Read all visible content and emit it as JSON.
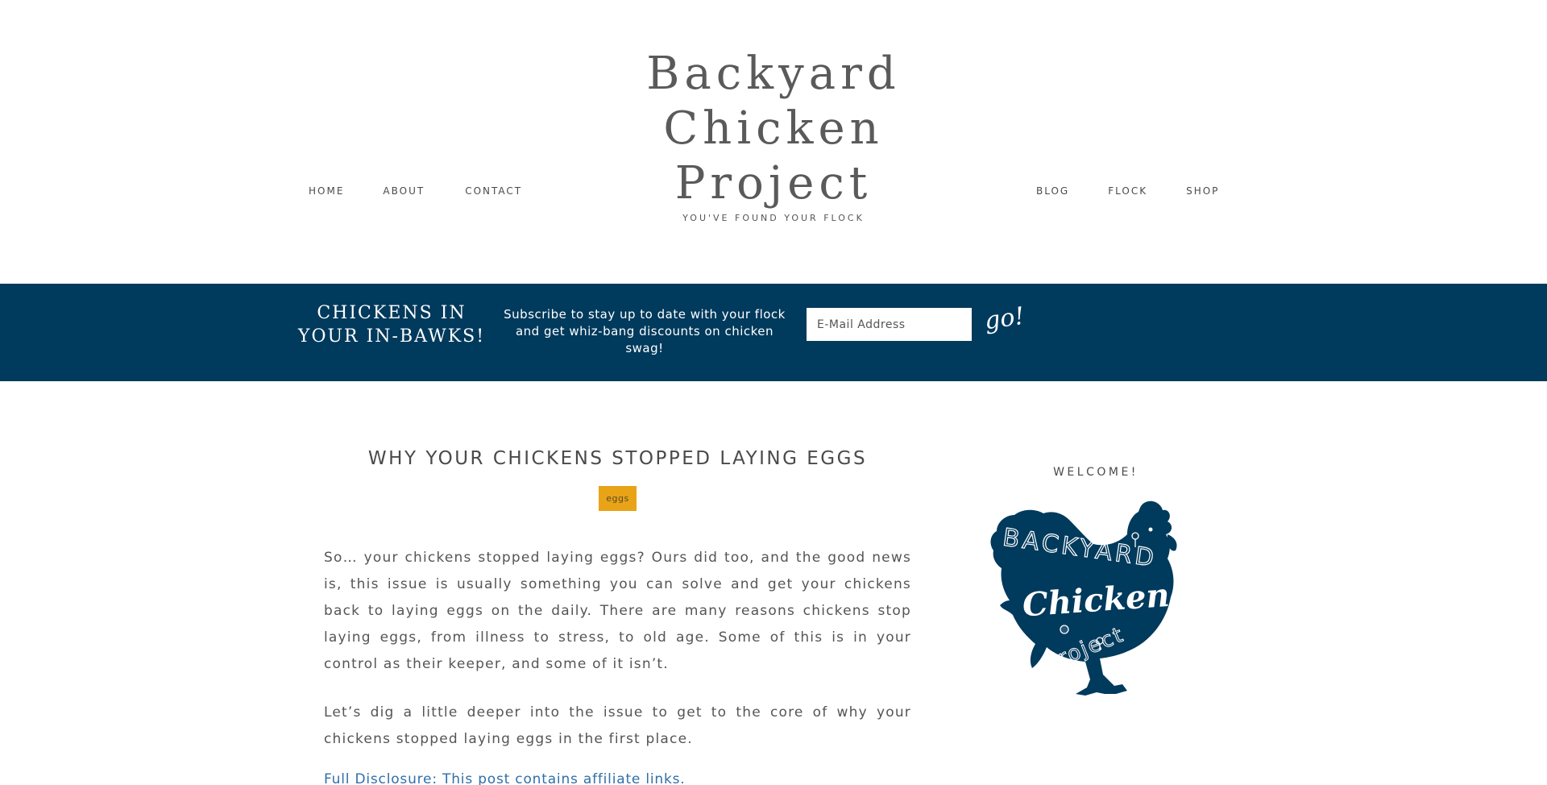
{
  "site": {
    "title_lines": [
      "Backyard",
      "Chicken",
      "Project"
    ],
    "tagline": "YOU'VE FOUND YOUR FLOCK"
  },
  "nav": {
    "left": [
      {
        "label": "HOME"
      },
      {
        "label": "ABOUT"
      },
      {
        "label": "CONTACT"
      }
    ],
    "right": [
      {
        "label": "BLOG"
      },
      {
        "label": "FLOCK"
      },
      {
        "label": "SHOP"
      }
    ]
  },
  "subscribe": {
    "heading_lines": [
      "CHICKENS IN",
      "YOUR IN-BAWKS!"
    ],
    "text": "Subscribe to stay up to date with your flock and get whiz-bang discounts on chicken swag!",
    "email_placeholder": "E-Mail Address",
    "button_label": "go!",
    "bg_color": "#003a5c"
  },
  "article": {
    "title": "WHY YOUR CHICKENS STOPPED LAYING EGGS",
    "tag": "eggs",
    "tag_color": "#e8a317",
    "paragraphs": [
      "So… your chickens stopped laying eggs? Ours did too, and the good news is, this issue is usually something you can solve and get your chickens back to laying eggs on the daily. There are many reasons chickens stop laying eggs, from illness to stress, to old age. Some of this is in your control as their keeper, and some of it isn’t.",
      "Let’s dig a little deeper into the issue to get to the core of why your chickens stopped laying eggs in the first place."
    ],
    "disclosure": "Full Disclosure: This post contains affiliate links."
  },
  "sidebar": {
    "welcome_heading": "WELCOME!",
    "logo_text": {
      "word1": "BACKYARD",
      "word2": "Chicken",
      "word3": "Project"
    },
    "logo_color": "#003a5c",
    "logo_icon": "chicken-silhouette-icon"
  }
}
